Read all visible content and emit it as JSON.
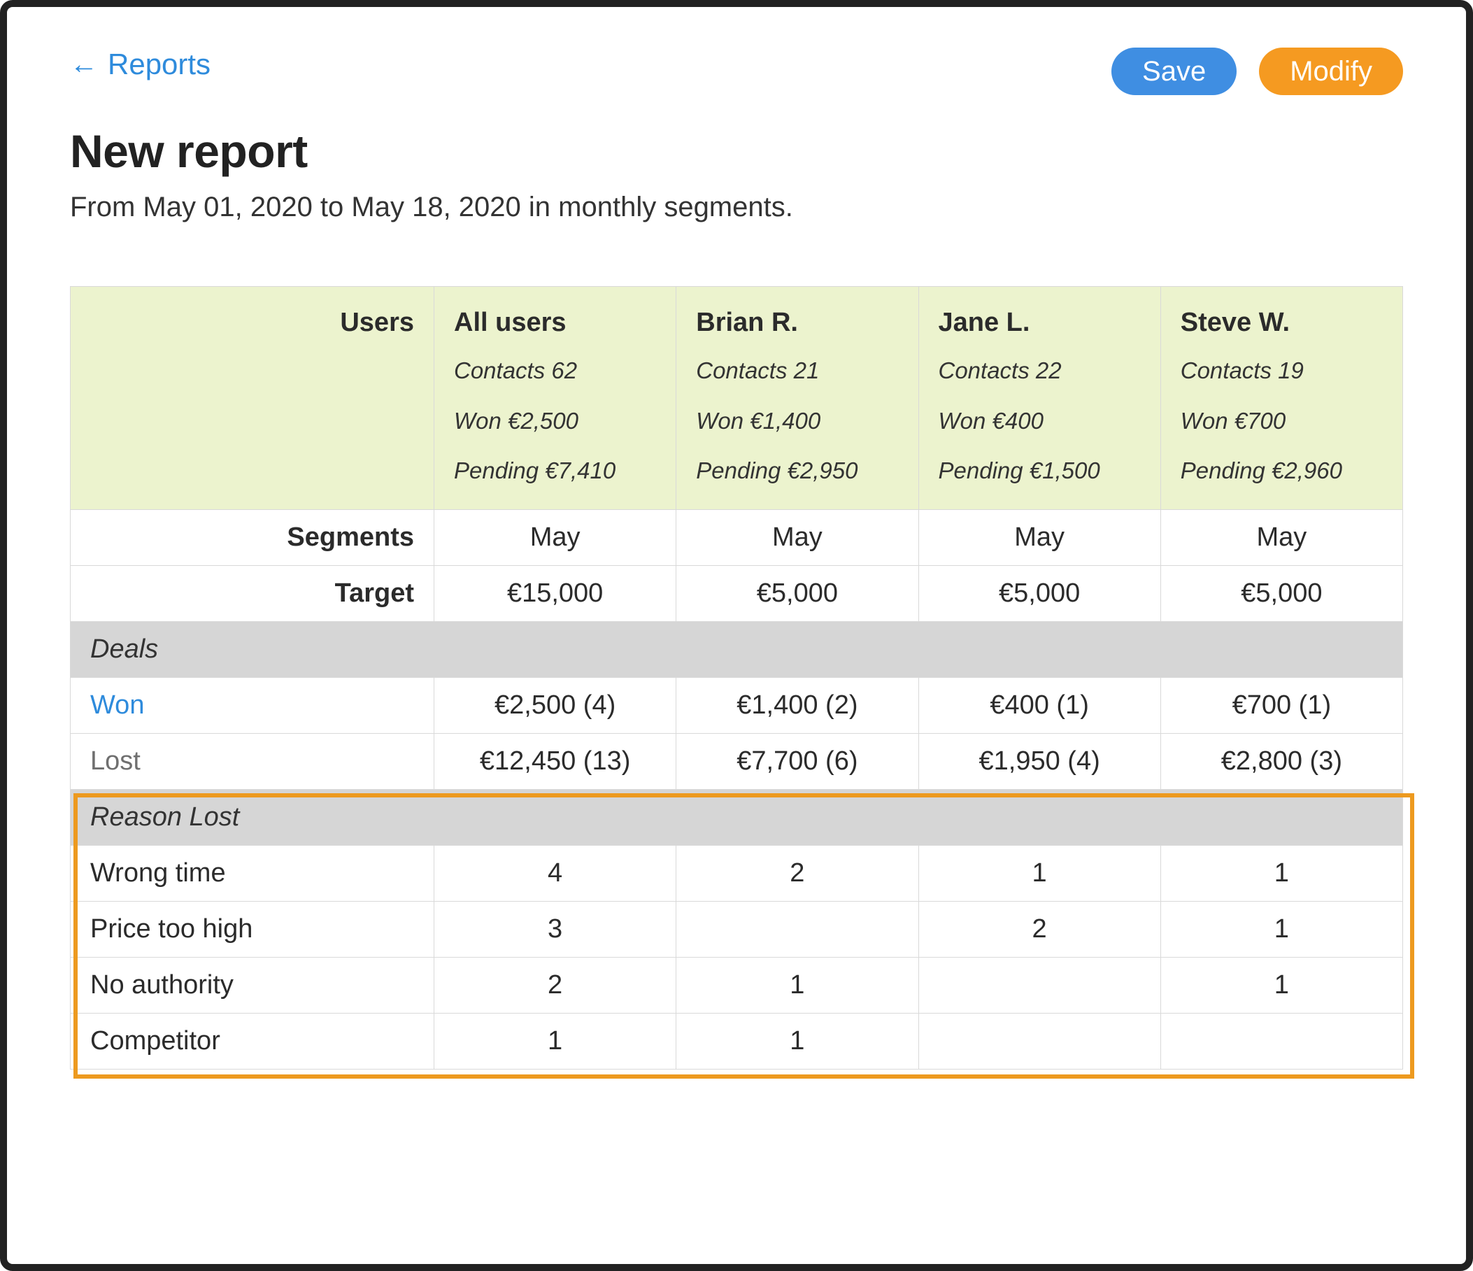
{
  "nav": {
    "back_label": "Reports"
  },
  "buttons": {
    "save": "Save",
    "modify": "Modify"
  },
  "header": {
    "title": "New report",
    "daterange": "From May 01, 2020 to May 18, 2020 in monthly segments."
  },
  "table": {
    "users_label": "Users",
    "columns": [
      {
        "name": "All users",
        "contacts": "Contacts 62",
        "won": "Won €2,500",
        "pending": "Pending €7,410"
      },
      {
        "name": "Brian R.",
        "contacts": "Contacts 21",
        "won": "Won €1,400",
        "pending": "Pending €2,950"
      },
      {
        "name": "Jane L.",
        "contacts": "Contacts 22",
        "won": "Won €400",
        "pending": "Pending €1,500"
      },
      {
        "name": "Steve W.",
        "contacts": "Contacts 19",
        "won": "Won €700",
        "pending": "Pending €2,960"
      }
    ],
    "segments": {
      "label": "Segments",
      "values": [
        "May",
        "May",
        "May",
        "May"
      ]
    },
    "target": {
      "label": "Target",
      "values": [
        "€15,000",
        "€5,000",
        "€5,000",
        "€5,000"
      ]
    },
    "deals_section": "Deals",
    "deals": {
      "won": {
        "label": "Won",
        "values": [
          "€2,500 (4)",
          "€1,400 (2)",
          "€400 (1)",
          "€700 (1)"
        ]
      },
      "lost": {
        "label": "Lost",
        "values": [
          "€12,450 (13)",
          "€7,700 (6)",
          "€1,950 (4)",
          "€2,800 (3)"
        ]
      }
    },
    "reason_section": "Reason Lost",
    "reasons": [
      {
        "label": "Wrong time",
        "values": [
          "4",
          "2",
          "1",
          "1"
        ]
      },
      {
        "label": "Price too high",
        "values": [
          "3",
          "",
          "2",
          "1"
        ]
      },
      {
        "label": "No authority",
        "values": [
          "2",
          "1",
          "",
          "1"
        ]
      },
      {
        "label": "Competitor",
        "values": [
          "1",
          "1",
          "",
          ""
        ]
      }
    ]
  }
}
